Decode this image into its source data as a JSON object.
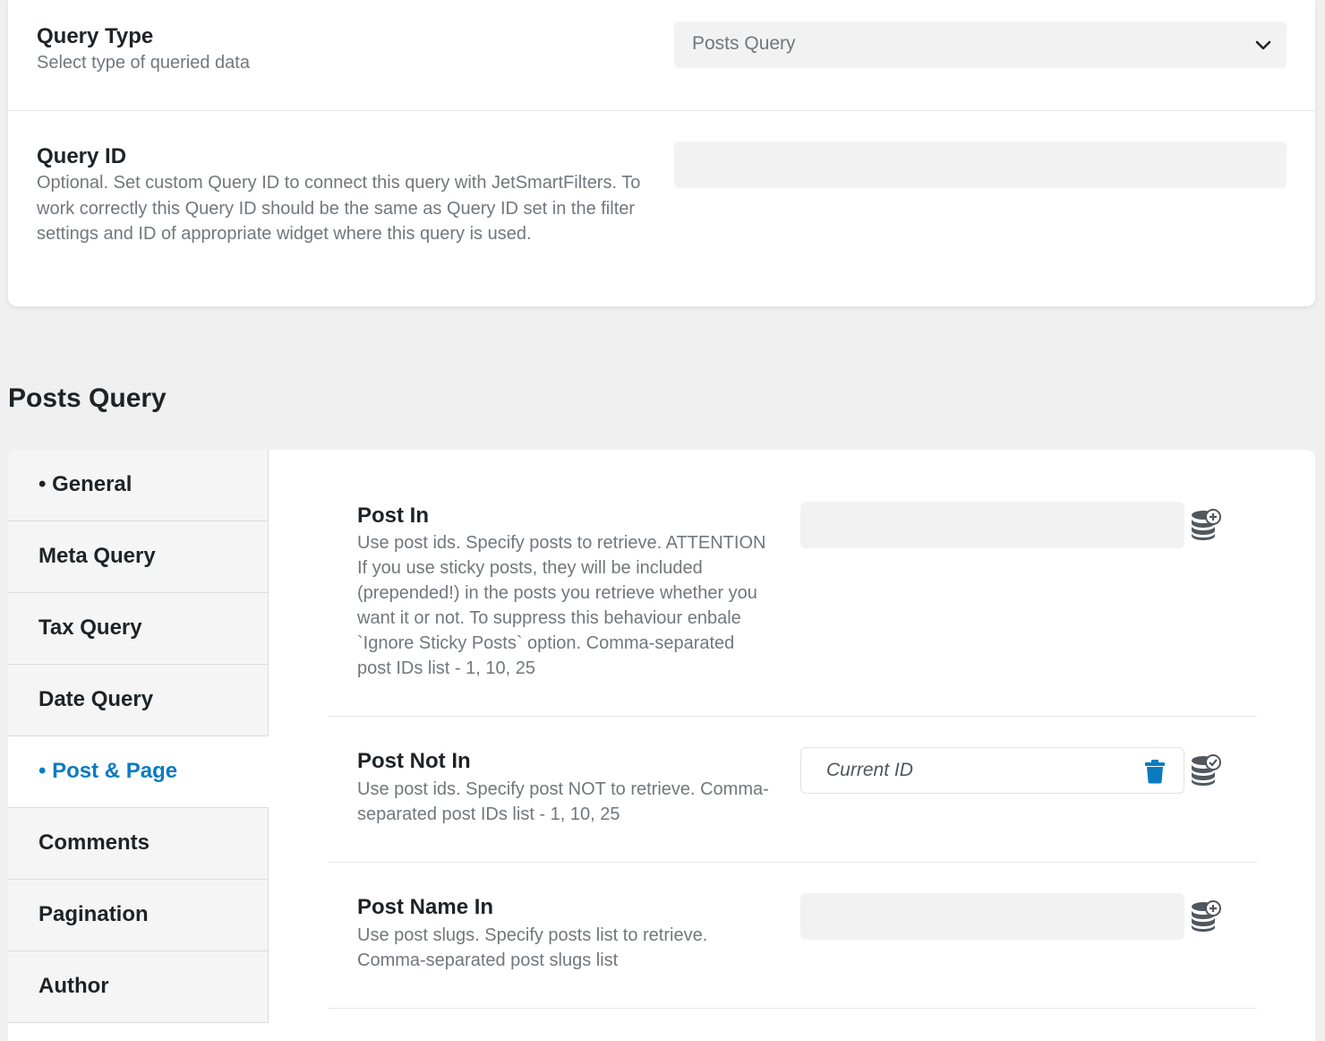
{
  "query_settings": {
    "query_type": {
      "label": "Query Type",
      "description": "Select type of queried data",
      "selected": "Posts Query"
    },
    "query_id": {
      "label": "Query ID",
      "description": "Optional. Set custom Query ID to connect this query with JetSmartFilters. To work correctly this Query ID should be the same as Query ID set in the filter settings and ID of appropriate widget where this query is used.",
      "value": ""
    }
  },
  "section_title": "Posts Query",
  "tabs": [
    {
      "label": "• General",
      "active": false
    },
    {
      "label": "Meta Query",
      "active": false
    },
    {
      "label": "Tax Query",
      "active": false
    },
    {
      "label": "Date Query",
      "active": false
    },
    {
      "label": "• Post & Page",
      "active": true
    },
    {
      "label": "Comments",
      "active": false
    },
    {
      "label": "Pagination",
      "active": false
    },
    {
      "label": "Author",
      "active": false
    }
  ],
  "fields": {
    "post_in": {
      "label": "Post In",
      "description": "Use post ids. Specify posts to retrieve. ATTENTION If you use sticky posts, they will be included (prepended!) in the posts you retrieve whether you want it or not. To suppress this behaviour enbale `Ignore Sticky Posts` option. Comma-separated post IDs list - 1, 10, 25",
      "value": ""
    },
    "post_not_in": {
      "label": "Post Not In",
      "description": "Use post ids. Specify post NOT to retrieve. Comma-separated post IDs list - 1, 10, 25",
      "value": "Current ID"
    },
    "post_name_in": {
      "label": "Post Name In",
      "description": "Use post slugs. Specify posts list to retrieve. Comma-separated post slugs list",
      "value": ""
    }
  },
  "colors": {
    "accent": "#0a7bbf",
    "icon_gray": "#50575e"
  }
}
